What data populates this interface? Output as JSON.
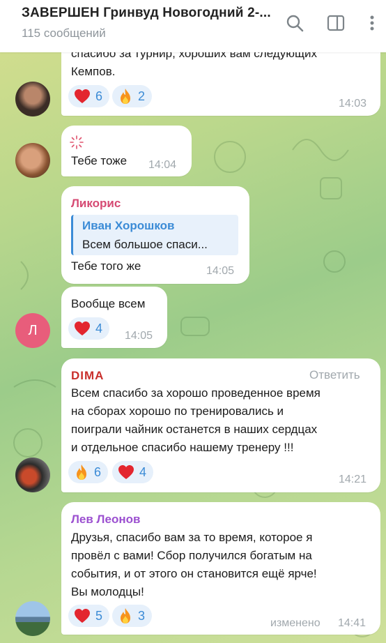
{
  "header": {
    "title": "ЗАВЕРШЕН Гринвуд Новогодний 2-...",
    "subtitle": "115 сообщений",
    "icons": [
      "search-icon",
      "sidebar-toggle-icon",
      "more-vert-icon"
    ]
  },
  "messages": [
    {
      "lines": [
        "спасибо за турнир, хороших вам следующих",
        "Кемпов."
      ],
      "reactions": [
        {
          "emoji": "heart",
          "count": "6"
        },
        {
          "emoji": "fire",
          "count": "2"
        }
      ],
      "time": "14:03"
    },
    {
      "sticker": "sparkle",
      "text": "Тебе тоже",
      "time": "14:04"
    },
    {
      "sender": "Ликорис",
      "sender_color": "#d64a73",
      "reply_name": "Иван Хорошков",
      "reply_text": "Всем большое спаси...",
      "text": "Тебе того же",
      "time": "14:05"
    },
    {
      "text": "Вообще всем",
      "reactions": [
        {
          "emoji": "heart",
          "count": "4"
        }
      ],
      "time": "14:05",
      "avatar_letter": "Л"
    },
    {
      "sender": "DIMA",
      "sender_color": "#c9302c",
      "reply_action": "Ответить",
      "lines": [
        "Всем спасибо за хорошо проведенное время",
        "на сборах хорошо по тренировались и",
        "поиграли  чайник останется в наших сердцах",
        "и отдельное спасибо нашему тренеру !!!"
      ],
      "reactions": [
        {
          "emoji": "fire",
          "count": "6"
        },
        {
          "emoji": "heart",
          "count": "4"
        }
      ],
      "time": "14:21"
    },
    {
      "sender": "Лев Леонов",
      "sender_color": "#9b4fd0",
      "lines": [
        "Друзья, спасибо вам за то время, которое я",
        "провёл с вами! Сбор получился богатым на",
        "события, и от этого он становится ещё ярче!",
        "Вы молодцы!"
      ],
      "reactions": [
        {
          "emoji": "heart",
          "count": "5"
        },
        {
          "emoji": "fire",
          "count": "3"
        }
      ],
      "edited": "изменено",
      "time": "14:41"
    }
  ],
  "colors": {
    "accent": "#3b8bd6",
    "reaction_bg": "#e6f0fb",
    "time": "#a1a8ad"
  }
}
